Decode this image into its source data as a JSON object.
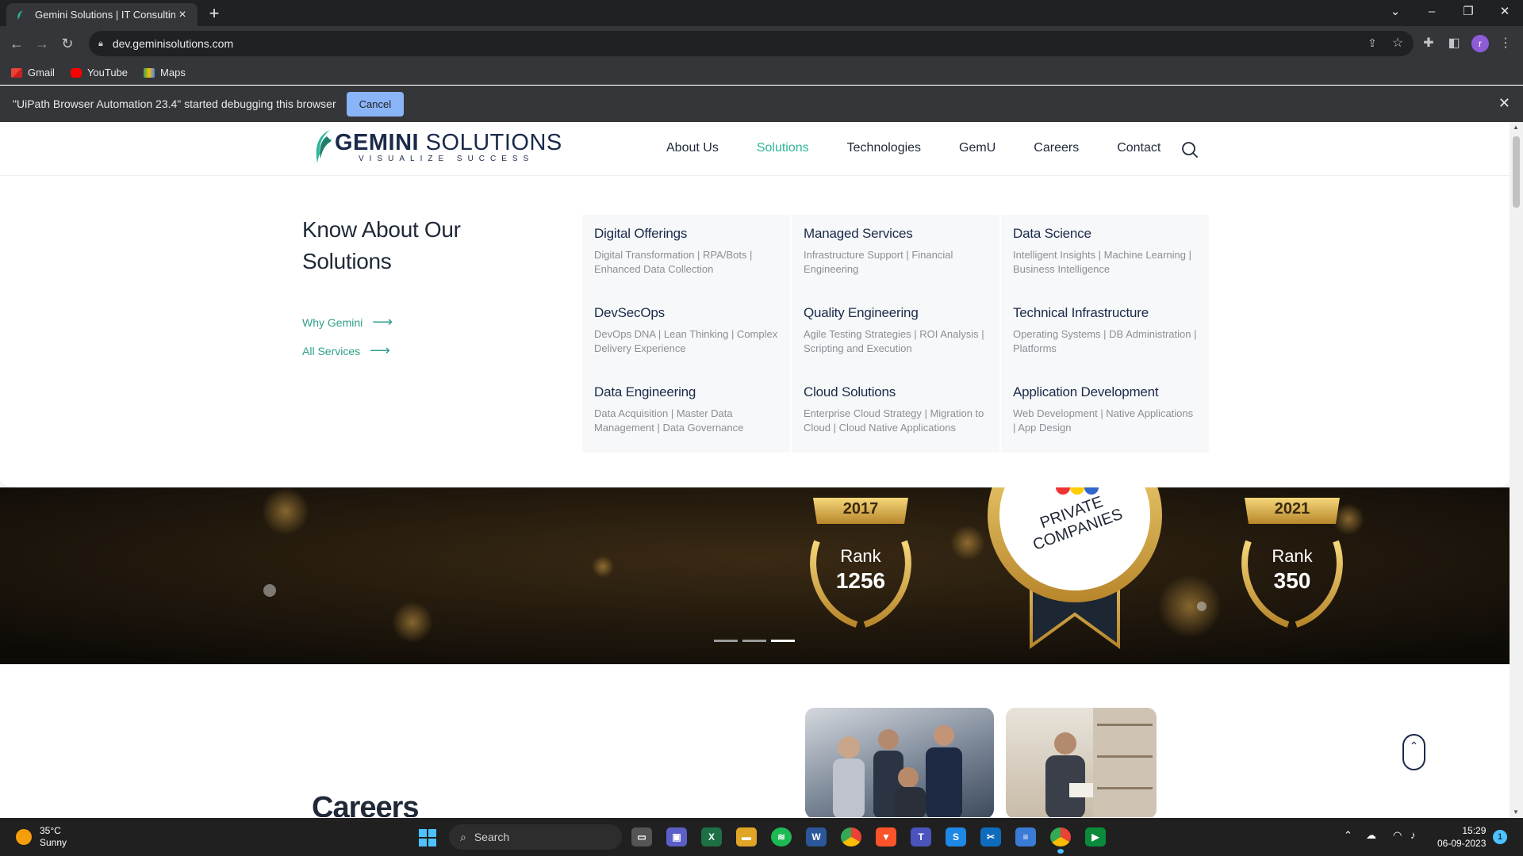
{
  "browser": {
    "tab_title": "Gemini Solutions | IT Consulting,",
    "url": "dev.geminisolutions.com",
    "bookmarks": [
      "Gmail",
      "YouTube",
      "Maps"
    ],
    "infobar_text": "\"UiPath Browser Automation 23.4\" started debugging this browser",
    "infobar_cancel": "Cancel",
    "profile_initial": "r"
  },
  "site": {
    "logo_brand_bold": "GEMINI",
    "logo_brand_rest": " SOLUTIONS",
    "logo_tagline": "VISUALIZE SUCCESS",
    "nav": [
      "About Us",
      "Solutions",
      "Technologies",
      "GemU",
      "Careers",
      "Contact"
    ],
    "nav_active": "Solutions"
  },
  "mega_menu": {
    "heading": "Know About Our Solutions",
    "links": [
      "Why Gemini",
      "All Services"
    ],
    "items": [
      {
        "title": "Digital Offerings",
        "desc": "Digital Transformation | RPA/Bots | Enhanced Data Collection"
      },
      {
        "title": "Managed Services",
        "desc": "Infrastructure Support | Financial Engineering"
      },
      {
        "title": "Data Science",
        "desc": "Intelligent Insights | Machine Learning | Business Intelligence"
      },
      {
        "title": "DevSecOps",
        "desc": "DevOps DNA | Lean Thinking | Complex Delivery Experience"
      },
      {
        "title": "Quality Engineering",
        "desc": "Agile Testing Strategies | ROI Analysis | Scripting and Execution"
      },
      {
        "title": "Technical Infrastructure",
        "desc": "Operating Systems | DB Administration | Platforms"
      },
      {
        "title": "Data Engineering",
        "desc": "Data Acquisition | Master Data Management | Data Governance"
      },
      {
        "title": "Cloud Solutions",
        "desc": "Enterprise Cloud Strategy | Migration to Cloud | Cloud Native Applications"
      },
      {
        "title": "Application Development",
        "desc": "Web Development | Native Applications | App Design"
      }
    ]
  },
  "banner": {
    "award_left": {
      "year": "2017",
      "label": "Rank",
      "rank": "1256"
    },
    "award_right": {
      "year": "2021",
      "label": "Rank",
      "rank": "350"
    },
    "seal_text": "PRIVATE COMPANIES",
    "slide_count": 3,
    "active_slide": 3
  },
  "careers": {
    "title": "Careers"
  },
  "taskbar": {
    "temperature": "35°C",
    "weather": "Sunny",
    "search_placeholder": "Search",
    "time": "15:29",
    "date": "06-09-2023",
    "notification_count": "1"
  },
  "colors": {
    "accent": "#2fb59a",
    "brand_navy": "#1b2a4a",
    "browser_dark": "#202124",
    "browser_toolbar": "#35363a"
  }
}
